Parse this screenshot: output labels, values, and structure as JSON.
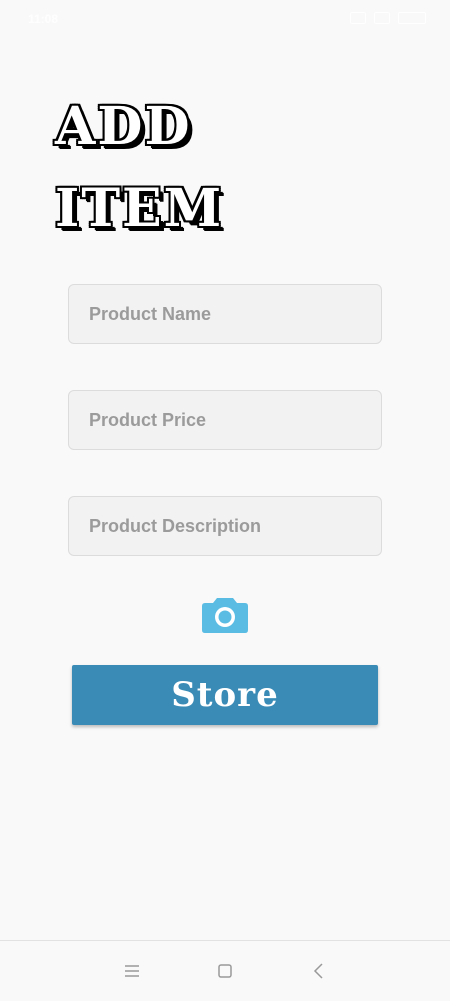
{
  "status_bar": {
    "time": "11:08"
  },
  "header": {
    "title_line1": "ADD",
    "title_line2": "ITEM"
  },
  "form": {
    "product_name": {
      "placeholder": "Product Name",
      "value": ""
    },
    "product_price": {
      "placeholder": "Product Price",
      "value": ""
    },
    "product_description": {
      "placeholder": "Product Description",
      "value": ""
    },
    "camera_icon": "camera-icon",
    "store_label": "Store"
  },
  "colors": {
    "background": "#f9f9f9",
    "accent_button": "#3a8bb6",
    "camera_icon": "#5bbce3",
    "field_background": "#f2f2f2"
  },
  "nav_bar": {
    "icons": [
      "menu-icon",
      "home-icon",
      "back-icon"
    ]
  }
}
